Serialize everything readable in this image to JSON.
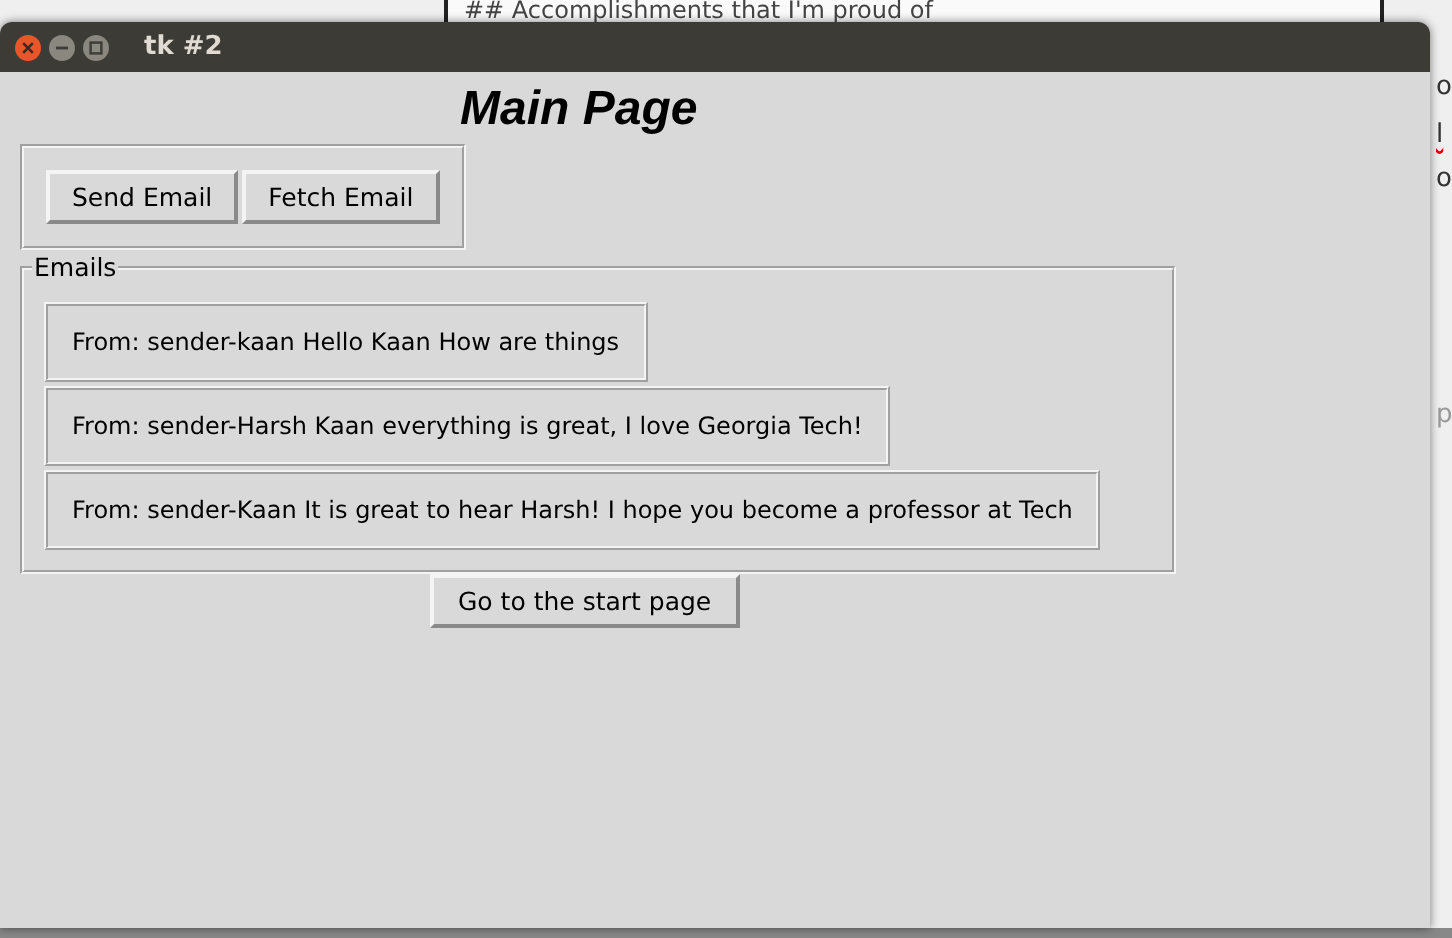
{
  "background_window": {
    "heading": "## Accomplishments that I'm proud of",
    "edge_fragments": [
      {
        "text": "o",
        "misspelled": false,
        "dimmed": false
      },
      {
        "text": "l",
        "misspelled": true,
        "dimmed": false
      },
      {
        "text": "o",
        "misspelled": false,
        "dimmed": false
      },
      {
        "text": "p",
        "misspelled": false,
        "dimmed": true
      }
    ]
  },
  "window": {
    "title": "tk #2"
  },
  "page_title": "Main Page",
  "toolbar_buttons": [
    "Send Email",
    "Fetch Email"
  ],
  "emails": {
    "label": "Emails",
    "items": [
      "From: sender-kaan Hello Kaan How are things",
      "From: sender-Harsh Kaan everything is great, I love Georgia Tech!",
      "From: sender-Kaan It is great to hear Harsh! I hope you become a professor at Tech"
    ]
  },
  "footer_button": "Go to the start page"
}
